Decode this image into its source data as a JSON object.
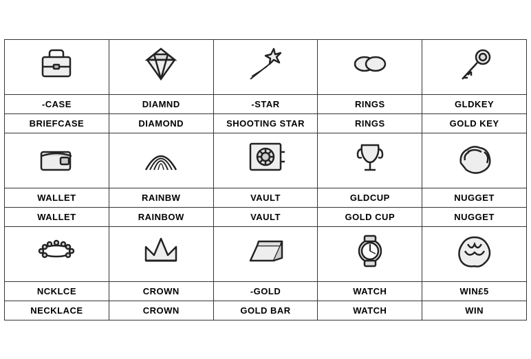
{
  "items": [
    {
      "id": "briefcase",
      "ocr": "-CASE",
      "correct": "BRIEFCASE",
      "icon": "briefcase"
    },
    {
      "id": "diamond",
      "ocr": "DIAMND",
      "correct": "DIAMOND",
      "icon": "diamond"
    },
    {
      "id": "shooting-star",
      "ocr": "-STAR",
      "correct": "SHOOTING STAR",
      "icon": "shooting-star"
    },
    {
      "id": "rings",
      "ocr": "RINGS",
      "correct": "RINGS",
      "icon": "rings"
    },
    {
      "id": "goldkey",
      "ocr": "GLDKEY",
      "correct": "GOLD KEY",
      "icon": "goldkey"
    },
    {
      "id": "wallet",
      "ocr": "WALLET",
      "correct": "WALLET",
      "icon": "wallet"
    },
    {
      "id": "rainbow",
      "ocr": "RAINBW",
      "correct": "RAINBOW",
      "icon": "rainbow"
    },
    {
      "id": "vault",
      "ocr": "VAULT",
      "correct": "VAULT",
      "icon": "vault"
    },
    {
      "id": "goldcup",
      "ocr": "GLDCUP",
      "correct": "GOLD CUP",
      "icon": "goldcup"
    },
    {
      "id": "nugget",
      "ocr": "NUGGET",
      "correct": "NUGGET",
      "icon": "nugget"
    },
    {
      "id": "necklace",
      "ocr": "NCKLCE",
      "correct": "NECKLACE",
      "icon": "necklace"
    },
    {
      "id": "crown",
      "ocr": "CROWN",
      "correct": "CROWN",
      "icon": "crown"
    },
    {
      "id": "goldbar",
      "ocr": "-GOLD",
      "correct": "GOLD BAR",
      "icon": "goldbar"
    },
    {
      "id": "watch",
      "ocr": "WATCH",
      "correct": "WATCH",
      "icon": "watch"
    },
    {
      "id": "win",
      "ocr": "WIN£5",
      "correct": "WIN",
      "icon": "win"
    }
  ]
}
